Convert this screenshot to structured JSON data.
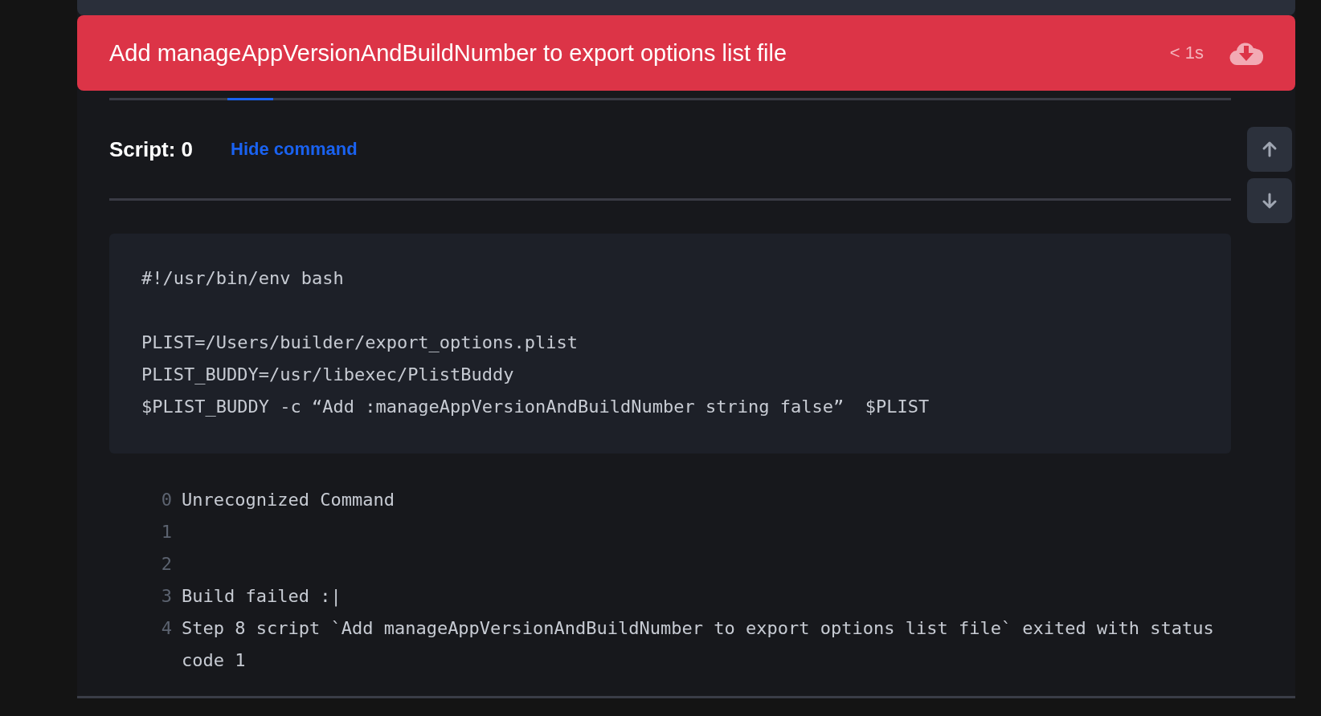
{
  "header": {
    "title": "Add manageAppVersionAndBuildNumber to export options list file",
    "duration": "< 1s"
  },
  "script": {
    "label": "Script: 0",
    "toggle": "Hide command"
  },
  "command": "#!/usr/bin/env bash\n\nPLIST=/Users/builder/export_options.plist\nPLIST_BUDDY=/usr/libexec/PlistBuddy\n$PLIST_BUDDY -c “Add :manageAppVersionAndBuildNumber string false”  $PLIST",
  "log": [
    {
      "number": "0",
      "text": "Unrecognized Command"
    },
    {
      "number": "1"
    },
    {
      "number": "2"
    },
    {
      "number": "3",
      "text": "Build failed :|"
    },
    {
      "number": "4",
      "text": "Step 8 script `Add manageAppVersionAndBuildNumber to export options list file` exited with status code 1"
    }
  ]
}
